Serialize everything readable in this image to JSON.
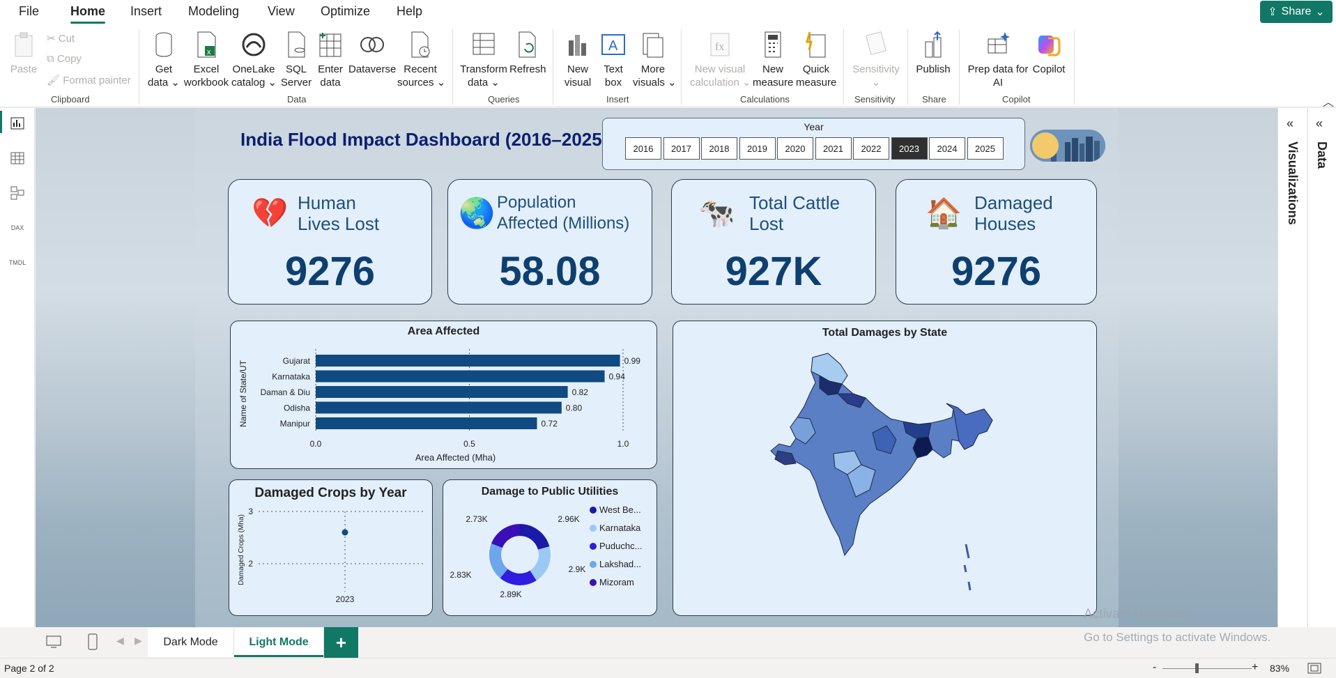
{
  "menu": {
    "items": [
      "File",
      "Home",
      "Insert",
      "Modeling",
      "View",
      "Optimize",
      "Help"
    ],
    "share_label": "Share"
  },
  "ribbon": {
    "clipboard": {
      "paste": "Paste",
      "cut": "Cut",
      "copy": "Copy",
      "format_painter": "Format painter",
      "group": "Clipboard"
    },
    "data": {
      "get_data": [
        "Get",
        "data"
      ],
      "excel": [
        "Excel",
        "workbook"
      ],
      "onelake": [
        "OneLake",
        "catalog"
      ],
      "sql": [
        "SQL",
        "Server"
      ],
      "enter": [
        "Enter",
        "data"
      ],
      "dataverse": "Dataverse",
      "recent": [
        "Recent",
        "sources"
      ],
      "group": "Data"
    },
    "queries": {
      "transform": [
        "Transform",
        "data"
      ],
      "refresh": "Refresh",
      "group": "Queries"
    },
    "insert": {
      "new_visual": [
        "New",
        "visual"
      ],
      "text_box": [
        "Text",
        "box"
      ],
      "more_visuals": [
        "More",
        "visuals"
      ],
      "group": "Insert"
    },
    "calculations": {
      "new_visual_calc": [
        "New visual",
        "calculation"
      ],
      "new_measure": [
        "New",
        "measure"
      ],
      "quick_measure": [
        "Quick",
        "measure"
      ],
      "group": "Calculations"
    },
    "sensitivity": {
      "label": "Sensitivity",
      "group": "Sensitivity"
    },
    "share": {
      "publish": "Publish",
      "group": "Share"
    },
    "copilot": {
      "prep": [
        "Prep data for",
        "AI"
      ],
      "copilot": "Copilot",
      "group": "Copilot"
    }
  },
  "dashboard": {
    "title": "India Flood Impact Dashboard (2016–2025)",
    "year_label": "Year",
    "years": [
      "2016",
      "2017",
      "2018",
      "2019",
      "2020",
      "2021",
      "2022",
      "2023",
      "2024",
      "2025"
    ],
    "selected_year": "2023",
    "kpis": [
      {
        "emoji": "💔",
        "title": [
          "Human",
          "Lives Lost"
        ],
        "value": "9276"
      },
      {
        "emoji": "🌏",
        "title": [
          "Population",
          "Affected (Millions)"
        ],
        "value": "58.08"
      },
      {
        "emoji": "🐄",
        "title": [
          "Total Cattle",
          "Lost"
        ],
        "value": "927K"
      },
      {
        "emoji": "🏠",
        "title": [
          "Damaged",
          "Houses"
        ],
        "value": "9276"
      }
    ],
    "map_title": "Total Damages by State"
  },
  "chart_data": [
    {
      "type": "bar",
      "title": "Area Affected",
      "orientation": "horizontal",
      "categories": [
        "Gujarat",
        "Karnataka",
        "Daman & Diu",
        "Odisha",
        "Manipur"
      ],
      "values": [
        0.99,
        0.94,
        0.82,
        0.8,
        0.72
      ],
      "value_labels": [
        "0.99",
        "0.94",
        "0.82",
        "0.80",
        "0.72"
      ],
      "xlabel": "Area Affected (Mha)",
      "ylabel": "Name of State/UT",
      "xlim": [
        0,
        1.0
      ],
      "xticks": [
        "0.0",
        "0.5",
        "1.0"
      ],
      "color": "#0f4a80"
    },
    {
      "type": "scatter",
      "title": "Damaged Crops by Year",
      "x": [
        "2023"
      ],
      "y": [
        2.6
      ],
      "ylabel": "Damaged Crops (Mha)",
      "ylim": [
        2,
        3
      ],
      "yticks": [
        "3",
        "2"
      ],
      "color": "#0f4a80"
    },
    {
      "type": "pie",
      "subtype": "donut",
      "title": "Damage to Public Utilities",
      "labels": [
        "West Be...",
        "Karnataka",
        "Puduchc...",
        "Lakshad...",
        "Mizoram"
      ],
      "values": [
        2.96,
        2.9,
        2.89,
        2.83,
        2.73
      ],
      "value_labels": [
        "2.96K",
        "2.9K",
        "2.89K",
        "2.83K",
        "2.73K"
      ],
      "colors": [
        "#1b1aa8",
        "#9cc8f4",
        "#2f1de0",
        "#6ea6ec",
        "#3a0fb8"
      ]
    }
  ],
  "tabs": {
    "items": [
      "Dark Mode",
      "Light Mode"
    ],
    "active": "Light Mode",
    "add_label": "+"
  },
  "status": {
    "page": "Page 2 of 2",
    "zoom": "83%",
    "zoom_minus": "-",
    "zoom_plus": "+"
  },
  "panes": {
    "visualizations": "Visualizations",
    "data": "Data"
  },
  "watermark": {
    "line1": "Activate Windows",
    "line2": "Go to Settings to activate Windows."
  }
}
